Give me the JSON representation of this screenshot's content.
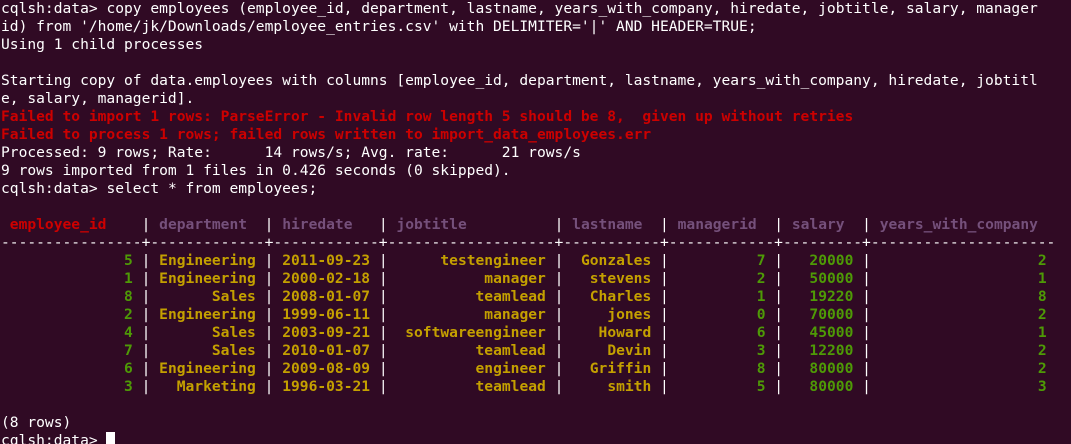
{
  "terminal": {
    "prompt": "cqlsh:data> ",
    "command_line1": "copy employees (employee_id, department, lastname, years_with_company, hiredate, jobtitle, salary, manager",
    "command_line2": "id) from '/home/jk/Downloads/employee_entries.csv' with DELIMITER='|' AND HEADER=TRUE;",
    "child_processes": "Using 1 child processes",
    "starting_copy_line1": "Starting copy of data.employees with columns [employee_id, department, lastname, years_with_company, hiredate, jobtitl",
    "starting_copy_line2": "e, salary, managerid].",
    "error_parse": "Failed to import 1 rows: ParseError - Invalid row length 5 should be 8,  given up without retries",
    "error_process": "Failed to process 1 rows; failed rows written to import_data_employees.err",
    "processed": "Processed: 9 rows; Rate:      14 rows/s; Avg. rate:      21 rows/s",
    "rows_imported": "9 rows imported from 1 files in 0.426 seconds (0 skipped).",
    "select_command": "select * from employees;",
    "row_count": "(8 rows)"
  },
  "table": {
    "headers": [
      "employee_id",
      "department",
      "hiredate",
      "jobtitle",
      "lastname",
      "managerid",
      "salary",
      "years_with_company"
    ],
    "rows": [
      [
        "5",
        "Engineering",
        "2011-09-23",
        "testengineer",
        "Gonzales",
        "7",
        "20000",
        "2"
      ],
      [
        "1",
        "Engineering",
        "2000-02-18",
        "manager",
        "stevens",
        "2",
        "50000",
        "1"
      ],
      [
        "8",
        "Sales",
        "2008-01-07",
        "teamlead",
        "Charles",
        "1",
        "19220",
        "8"
      ],
      [
        "2",
        "Engineering",
        "1999-06-11",
        "manager",
        "jones",
        "0",
        "70000",
        "2"
      ],
      [
        "4",
        "Sales",
        "2003-09-21",
        "softwareengineer",
        "Howard",
        "6",
        "45000",
        "1"
      ],
      [
        "7",
        "Sales",
        "2010-01-07",
        "teamlead",
        "Devin",
        "3",
        "12200",
        "2"
      ],
      [
        "6",
        "Engineering",
        "2009-08-09",
        "engineer",
        "Griffin",
        "8",
        "80000",
        "2"
      ],
      [
        "3",
        "Marketing",
        "1996-03-21",
        "teamlead",
        "smith",
        "5",
        "80000",
        "3"
      ]
    ]
  },
  "colors": {
    "background": "#300a24",
    "error": "#cc0000",
    "header": "#75507b",
    "text_value": "#c4a000",
    "number_value": "#4e9a06"
  }
}
